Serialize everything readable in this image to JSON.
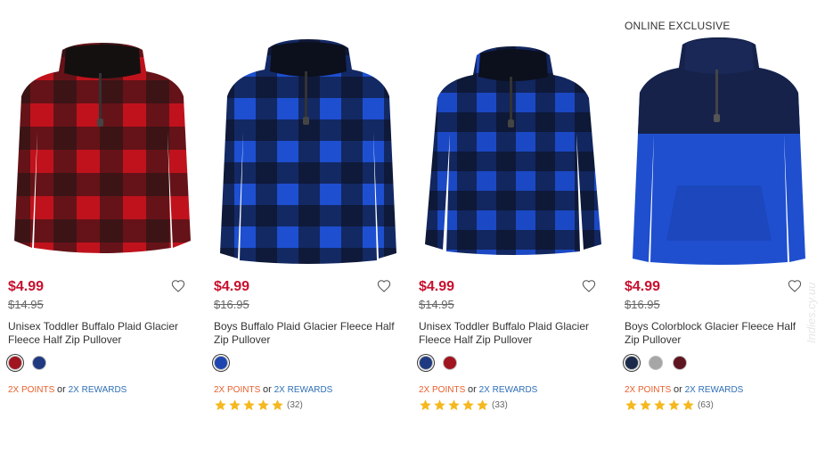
{
  "products": [
    {
      "badge": "",
      "sale_price": "$4.99",
      "original_price": "$14.95",
      "name": "Unisex Toddler Buffalo Plaid Glacier Fleece Half Zip Pullover",
      "image_icon": "red-plaid-fleece-pullover",
      "swatches": [
        {
          "color": "#a01520",
          "selected": true
        },
        {
          "color": "#1f3a80",
          "selected": false
        }
      ],
      "rewards": {
        "points": "2X POINTS",
        "or": "or",
        "rewards": "2X REWARDS"
      },
      "rating": null,
      "review_count": ""
    },
    {
      "badge": "",
      "sale_price": "$4.99",
      "original_price": "$16.95",
      "name": "Boys Buffalo Plaid Glacier Fleece Half Zip Pullover",
      "image_icon": "blue-plaid-fleece-pullover",
      "swatches": [
        {
          "color": "#1f46b0",
          "selected": true
        }
      ],
      "rewards": {
        "points": "2X POINTS",
        "or": "or",
        "rewards": "2X REWARDS"
      },
      "rating": 5,
      "review_count": "(32)"
    },
    {
      "badge": "",
      "sale_price": "$4.99",
      "original_price": "$14.95",
      "name": "Unisex Toddler Buffalo Plaid Glacier Fleece Half Zip Pullover",
      "image_icon": "blue-plaid-fleece-pullover",
      "swatches": [
        {
          "color": "#1f3a80",
          "selected": true
        },
        {
          "color": "#a01520",
          "selected": false
        }
      ],
      "rewards": {
        "points": "2X POINTS",
        "or": "or",
        "rewards": "2X REWARDS"
      },
      "rating": 5,
      "review_count": "(33)"
    },
    {
      "badge": "ONLINE EXCLUSIVE",
      "sale_price": "$4.99",
      "original_price": "$16.95",
      "name": "Boys Colorblock Glacier Fleece Half Zip Pullover",
      "image_icon": "navy-blue-colorblock-fleece-pullover",
      "swatches": [
        {
          "color": "#1b2a4a",
          "selected": true
        },
        {
          "color": "#a6a6a6",
          "selected": false
        },
        {
          "color": "#5e1520",
          "selected": false
        }
      ],
      "rewards": {
        "points": "2X POINTS",
        "or": "or",
        "rewards": "2X REWARDS"
      },
      "rating": 5,
      "review_count": "(63)"
    }
  ],
  "colors": {
    "sale_price": "#c8102e",
    "points": "#e8602c",
    "rewards": "#2d6fb7",
    "star": "#f5b81e"
  },
  "icons": {
    "favorite": "heart-outline-icon",
    "rating": "star-icon"
  },
  "watermark": "Indies.cy.uu"
}
